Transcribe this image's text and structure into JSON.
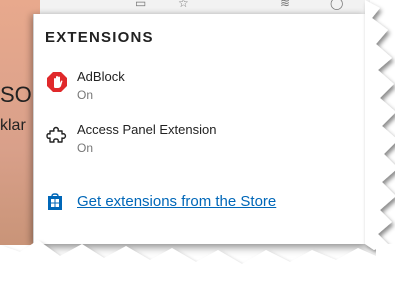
{
  "background": {
    "text_big": "SO",
    "text_small": "klar"
  },
  "panel": {
    "title": "EXTENSIONS",
    "extensions": [
      {
        "name": "AdBlock",
        "status": "On",
        "icon": "adblock-hand-icon"
      },
      {
        "name": "Access Panel Extension",
        "status": "On",
        "icon": "puzzle-piece-icon"
      }
    ],
    "store_link": {
      "label": "Get extensions from the Store",
      "icon": "windows-store-icon"
    }
  },
  "colors": {
    "accent_link": "#0067b8",
    "adblock_red": "#e0292b",
    "page_bg": "#e0a58a"
  }
}
